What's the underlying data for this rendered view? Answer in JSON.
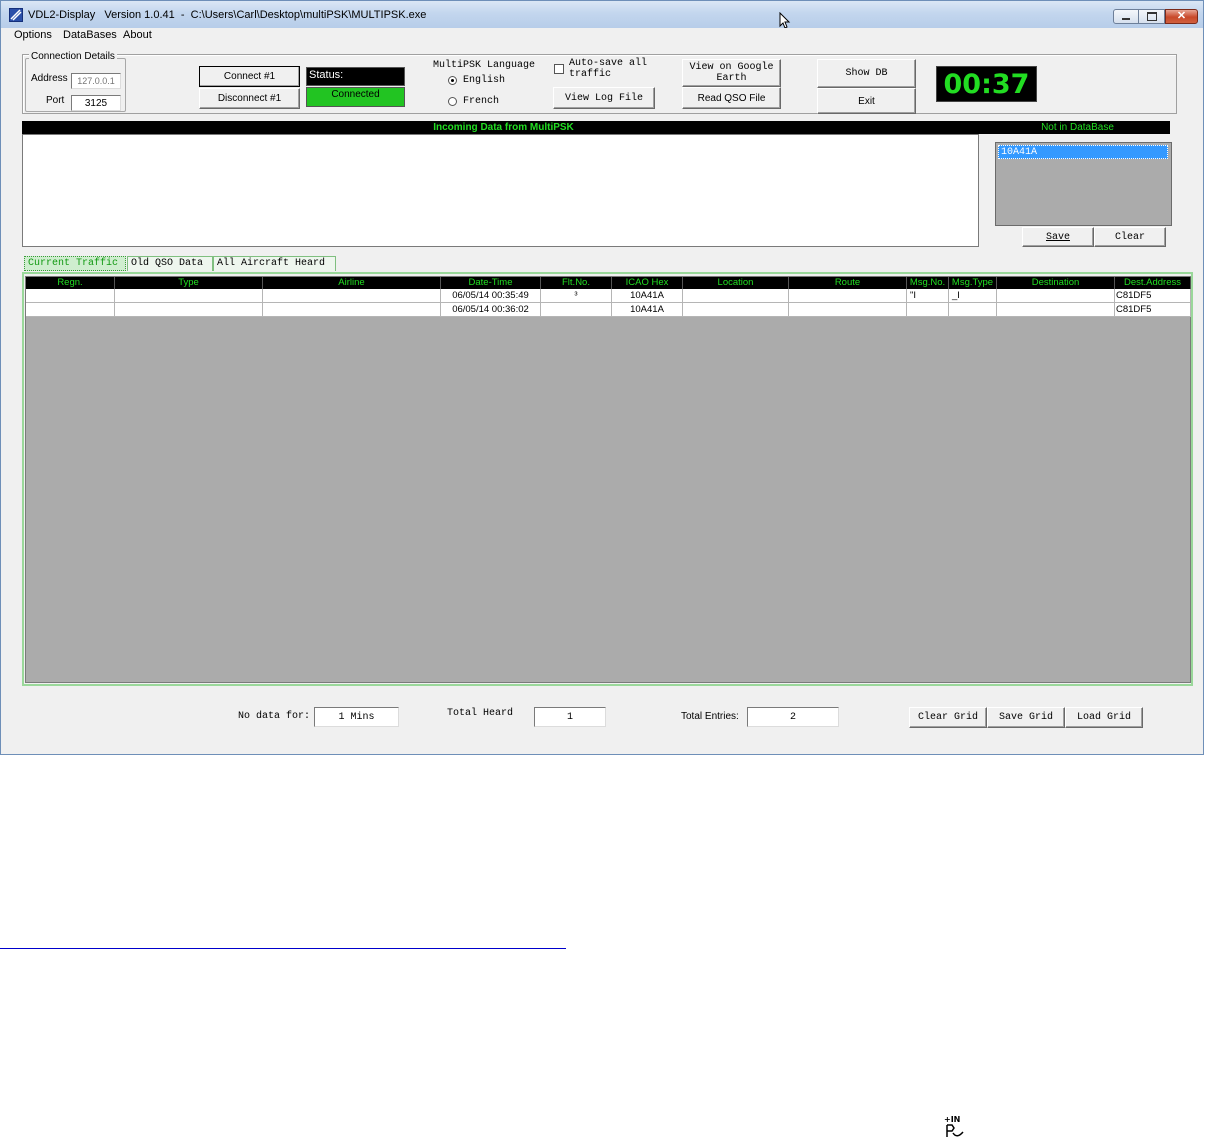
{
  "window": {
    "title": "VDL2-Display   Version 1.0.41  -  C:\\Users\\Carl\\Desktop\\multiPSK\\MULTIPSK.exe"
  },
  "menu": [
    "Options",
    "DataBases",
    "About"
  ],
  "connection": {
    "group_label": "Connection Details",
    "address_label": "Address",
    "address_value": "127.0.0.1",
    "port_label": "Port",
    "port_value": "3125",
    "connect_label": "Connect #1",
    "disconnect_label": "Disconnect #1",
    "status_label": "Status:",
    "status_value": "Connected"
  },
  "language": {
    "label": "MultiPSK Language",
    "options": [
      "English",
      "French"
    ],
    "selected": "English"
  },
  "autosave": {
    "label": "Auto-save all traffic",
    "checked": false
  },
  "buttons": {
    "view_log": "View Log File",
    "view_google_earth": "View on Google Earth",
    "read_qso": "Read QSO File",
    "show_db": "Show DB",
    "exit": "Exit"
  },
  "timer": "00:37",
  "incoming": {
    "header": "Incoming Data from MultiPSK"
  },
  "not_in_db": {
    "header": "Not in DataBase",
    "items": [
      "10A41A"
    ],
    "save_label": "Save",
    "clear_label": "Clear"
  },
  "tabs": [
    "Current Traffic",
    "Old QSO Data",
    "All Aircraft Heard"
  ],
  "grid": {
    "columns": [
      "Regn.",
      "Type",
      "Airline",
      "Date-Time",
      "Flt.No.",
      "ICAO Hex",
      "Location",
      "Route",
      "Msg.No.",
      "Msg.Type",
      "Destination",
      "Dest.Address"
    ],
    "rows": [
      [
        "",
        "",
        "",
        "06/05/14 00:35:49",
        "³",
        "10A41A",
        "",
        "",
        "\"I",
        "_I",
        "",
        "C81DF5"
      ],
      [
        "",
        "",
        "",
        "06/05/14 00:36:02",
        "",
        "10A41A",
        "",
        "",
        "",
        "",
        "",
        "C81DF5"
      ]
    ]
  },
  "footer": {
    "no_data_label": "No data for:",
    "no_data_value": "1 Mins",
    "total_heard_label": "Total Heard",
    "total_heard_value": "1",
    "total_entries_label": "Total Entries:",
    "total_entries_value": "2",
    "clear_grid": "Clear Grid",
    "save_grid": "Save Grid",
    "load_grid": "Load Grid"
  },
  "colors": {
    "accent_green": "#22dd22",
    "status_green": "#22c422",
    "grid_gray": "#ababab"
  },
  "icons": [
    "app-icon",
    "minimize-icon",
    "maximize-icon",
    "close-icon",
    "mouse-cursor-icon",
    "insert-mode-icon"
  ]
}
